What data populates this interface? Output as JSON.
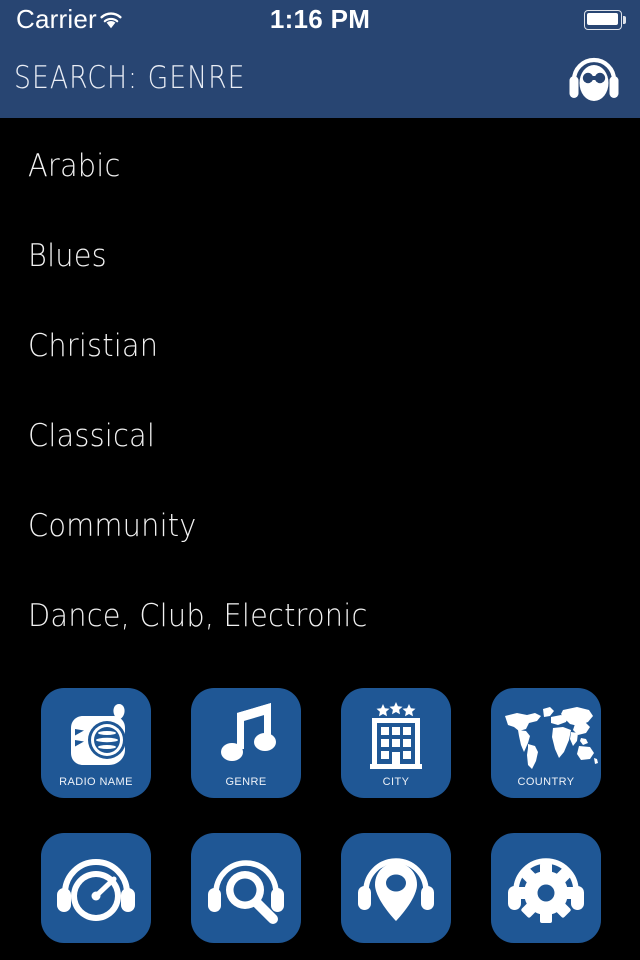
{
  "status_bar": {
    "carrier": "Carrier",
    "wifi_icon": "wifi-icon",
    "time": "1:16 PM",
    "battery_icon": "battery-full-icon"
  },
  "header": {
    "title": "SEARCH: GENRE",
    "logo_icon": "headphones-mascot-icon",
    "background_color": "#284572"
  },
  "genre_list": {
    "items": [
      {
        "label": "Arabic"
      },
      {
        "label": "Blues"
      },
      {
        "label": "Christian"
      },
      {
        "label": "Classical"
      },
      {
        "label": "Community"
      },
      {
        "label": "Dance, Club, Electronic"
      }
    ]
  },
  "tile_grid": {
    "tile_color": "#1f5795",
    "tiles": [
      {
        "label": "RADIO NAME",
        "icon": "radio-icon"
      },
      {
        "label": "GENRE",
        "icon": "music-note-icon"
      },
      {
        "label": "CITY",
        "icon": "hotel-building-stars-icon"
      },
      {
        "label": "COUNTRY",
        "icon": "world-map-icon"
      },
      {
        "label": "",
        "icon": "headphones-dial-icon"
      },
      {
        "label": "",
        "icon": "headphones-magnifier-icon"
      },
      {
        "label": "",
        "icon": "headphones-map-pin-icon"
      },
      {
        "label": "",
        "icon": "headphones-gear-icon"
      }
    ]
  }
}
